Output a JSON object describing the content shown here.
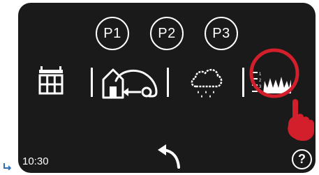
{
  "presets": [
    {
      "label": "P1"
    },
    {
      "label": "P2"
    },
    {
      "label": "P3"
    }
  ],
  "modes": [
    {
      "name": "schedule",
      "icon": "calendar-icon"
    },
    {
      "name": "home",
      "icon": "mower-return-home-icon"
    },
    {
      "name": "rain",
      "icon": "rain-cloud-icon"
    },
    {
      "name": "cutting-height",
      "icon": "grass-height-icon"
    }
  ],
  "status": {
    "time": "10:30"
  },
  "help": {
    "label": "?"
  },
  "colors": {
    "screen": "#1a1a1a",
    "foreground": "#ffffff",
    "highlight": "#d21f2b",
    "corner_mark": "#2e6fb8"
  },
  "icons": {
    "back": "back-arrow-icon",
    "pointer": "tapping-hand-icon",
    "highlight": "red-selection-circle"
  }
}
